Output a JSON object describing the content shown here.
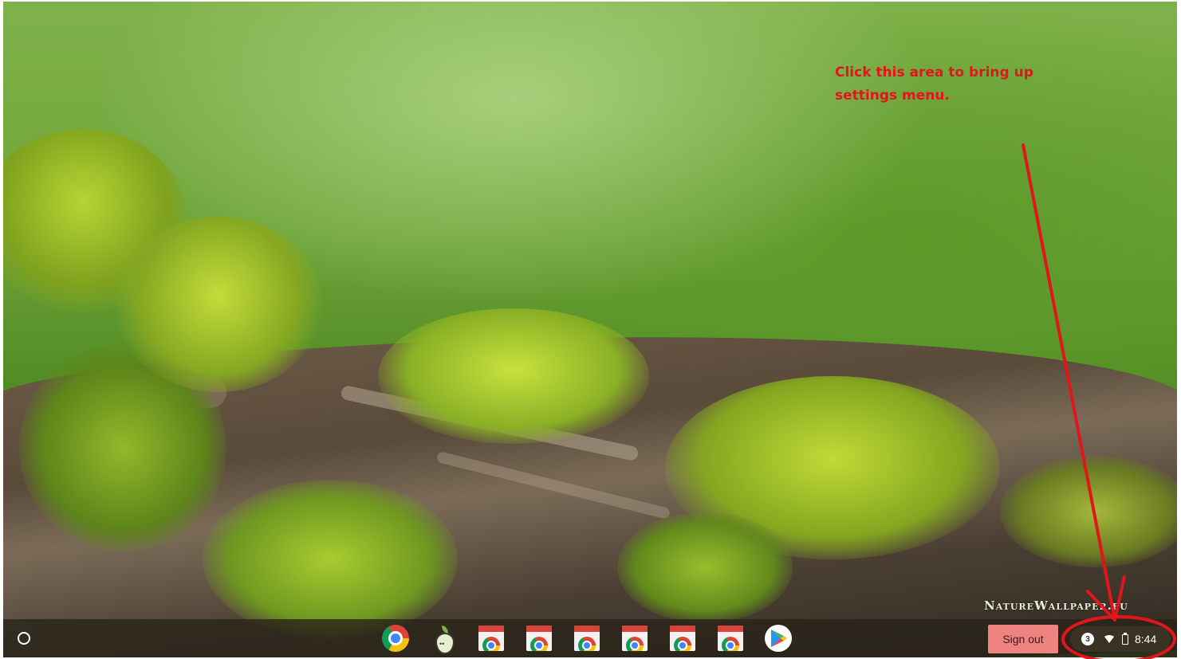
{
  "annotation": {
    "line1": "Click this area to bring up",
    "line2": "settings menu.",
    "color": "#e0161b"
  },
  "wallpaper": {
    "watermark": "NatureWallpaper.eu"
  },
  "shelf": {
    "launcher_icon": "launcher-circle-icon",
    "apps": [
      {
        "icon": "chrome-icon"
      },
      {
        "icon": "pear-deck-icon"
      },
      {
        "icon": "chrome-web-app-icon"
      },
      {
        "icon": "chrome-web-app-icon"
      },
      {
        "icon": "chrome-web-app-icon"
      },
      {
        "icon": "chrome-web-app-icon"
      },
      {
        "icon": "chrome-web-app-icon"
      },
      {
        "icon": "chrome-web-app-icon"
      },
      {
        "icon": "google-play-icon"
      }
    ],
    "sign_out_label": "Sign out",
    "sign_out_color": "#ef8380"
  },
  "status_tray": {
    "notification_count": "3",
    "wifi_icon": "wifi-icon",
    "battery_icon": "battery-icon",
    "time": "8:44"
  }
}
